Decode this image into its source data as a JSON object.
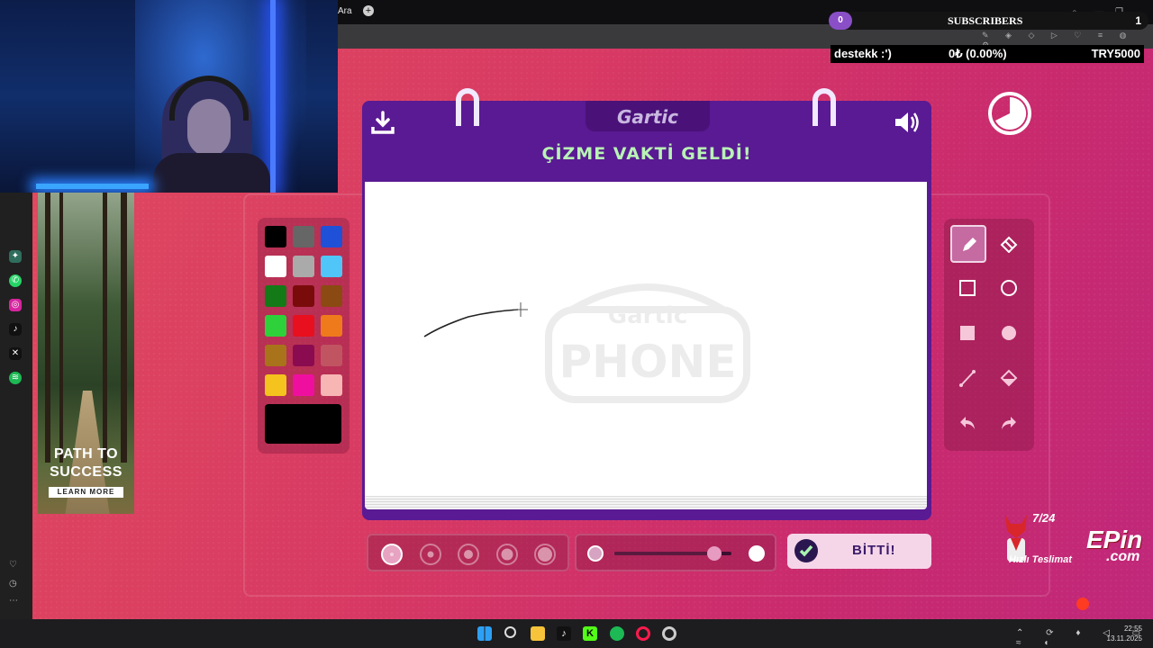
{
  "browser": {
    "tab_label": "Ara",
    "new_tab_symbol": "+"
  },
  "stream_overlay": {
    "subscribers_title": "SUBSCRIBERS",
    "subscribers_left_count": "0",
    "subscribers_right_count": "1",
    "donation_label": "destekk :')",
    "donation_progress": "0₺ (0.00%)",
    "donation_goal": "TRY5000"
  },
  "ad": {
    "headline_line1": "PATH TO",
    "headline_line2": "SUCCESS",
    "cta": "LEARN MORE"
  },
  "game": {
    "logo": "Gartic",
    "title": "ÇİZME VAKTİ GELDİ!",
    "done_label": "BİTTİ!",
    "watermark_line1": "Gartic",
    "watermark_line2": "PHONE",
    "palette": [
      "#000000",
      "#666666",
      "#1e50d8",
      "#ffffff",
      "#aaaaaa",
      "#4fc6f7",
      "#137a17",
      "#7a0b0b",
      "#8a4a12",
      "#2ed13a",
      "#e8101e",
      "#ef7a1c",
      "#a9731b",
      "#8a0b4f",
      "#c05561",
      "#f4c31d",
      "#ef0f9f",
      "#f7b5b3"
    ],
    "current_color": "#000000",
    "active_tool": "pencil",
    "brush_sizes": 5,
    "active_brush_size": 1,
    "opacity_level": 0.85
  },
  "sponsor": {
    "count": "7/24",
    "brand": "EPin",
    "tagline": "Hızlı Teslimat",
    "dotcom": ".com"
  },
  "taskbar": {
    "time": "22:55",
    "date": "13.11.2025"
  }
}
